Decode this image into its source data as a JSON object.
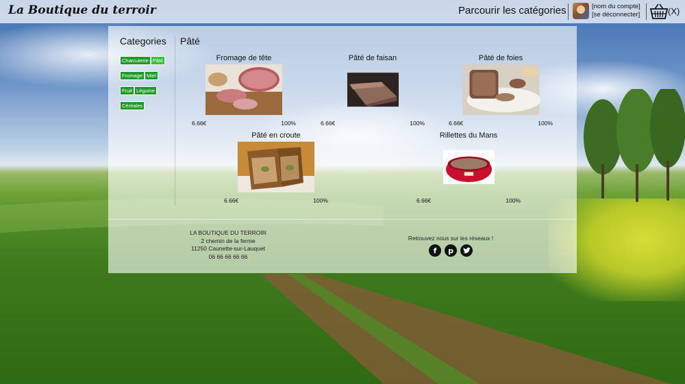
{
  "header": {
    "brand": "La Boutique du terroir",
    "browse_label": "Parcourir les catégories",
    "account_name": "[nom du compte]",
    "logout_label": "[se déconnecter]",
    "cart_count": "(X)",
    "icons": {
      "avatar": "user-avatar",
      "cart": "basket-icon"
    }
  },
  "sidebar": {
    "title": "Categories",
    "tags": [
      {
        "label": "Charcuterie",
        "active": false
      },
      {
        "label": "Pâté",
        "active": true
      },
      {
        "label": "Fromage",
        "active": false
      },
      {
        "label": "Miel",
        "active": false
      },
      {
        "label": "Fruit",
        "active": false
      },
      {
        "label": "Légume",
        "active": false
      },
      {
        "label": "Céréales",
        "active": false
      }
    ]
  },
  "section": {
    "title": "Pâté"
  },
  "products": [
    {
      "name": "Fromage de tête",
      "price": "6.66€",
      "percent": "100%",
      "image": "sliced-head-cheese"
    },
    {
      "name": "Pâté de faisan",
      "price": "6.66€",
      "percent": "100%",
      "image": "pheasant-pate"
    },
    {
      "name": "Pâté de foies",
      "price": "6.66€",
      "percent": "100%",
      "image": "liver-pate-board"
    },
    {
      "name": "Pâté en croute",
      "price": "6.66€",
      "percent": "100%",
      "image": "pate-en-croute"
    },
    {
      "name": "Rillettes du Mans",
      "price": "6.66€",
      "percent": "100%",
      "image": "rillettes-bowl"
    }
  ],
  "footer": {
    "address": [
      "LA BOUTIQUE DU TERROIR",
      "2 chemin de la ferme",
      "11250 Caunette-sur-Lauquet",
      "06 66 66 66 66"
    ],
    "social_text": "Retrouvez nous sur les réseaux !",
    "social_icons": [
      "facebook-icon",
      "pinterest-icon",
      "twitter-icon"
    ]
  },
  "colors": {
    "tag_bg": "#1f9a28",
    "tag_active_bg": "#2fc23a",
    "panel_bg": "rgba(255,255,255,0.62)"
  }
}
